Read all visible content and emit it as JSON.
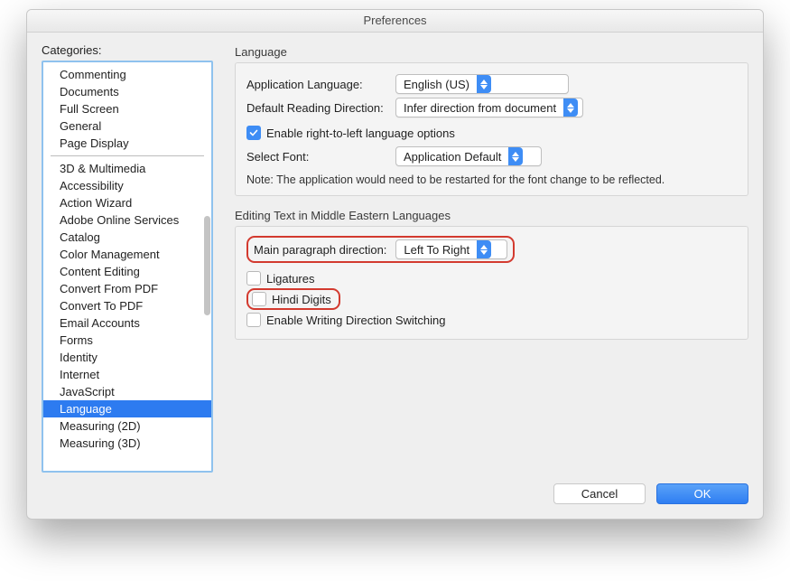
{
  "window": {
    "title": "Preferences"
  },
  "sidebar": {
    "label": "Categories:",
    "group1": [
      "Commenting",
      "Documents",
      "Full Screen",
      "General",
      "Page Display"
    ],
    "group2": [
      "3D & Multimedia",
      "Accessibility",
      "Action Wizard",
      "Adobe Online Services",
      "Catalog",
      "Color Management",
      "Content Editing",
      "Convert From PDF",
      "Convert To PDF",
      "Email Accounts",
      "Forms",
      "Identity",
      "Internet",
      "JavaScript",
      "Language",
      "Measuring (2D)",
      "Measuring (3D)"
    ],
    "selected": "Language"
  },
  "lang": {
    "section": "Language",
    "app_label": "Application Language:",
    "app_value": "English (US)",
    "dir_label": "Default Reading Direction:",
    "dir_value": "Infer direction from document",
    "rtl_label": "Enable right-to-left language options",
    "font_label": "Select Font:",
    "font_value": "Application Default",
    "note": "Note: The application would need to be restarted for the font change to be reflected."
  },
  "me": {
    "section": "Editing Text in Middle Eastern Languages",
    "para_label": "Main paragraph direction:",
    "para_value": "Left To Right",
    "ligatures": "Ligatures",
    "hindi": "Hindi Digits",
    "switch": "Enable Writing Direction Switching"
  },
  "footer": {
    "cancel": "Cancel",
    "ok": "OK"
  }
}
